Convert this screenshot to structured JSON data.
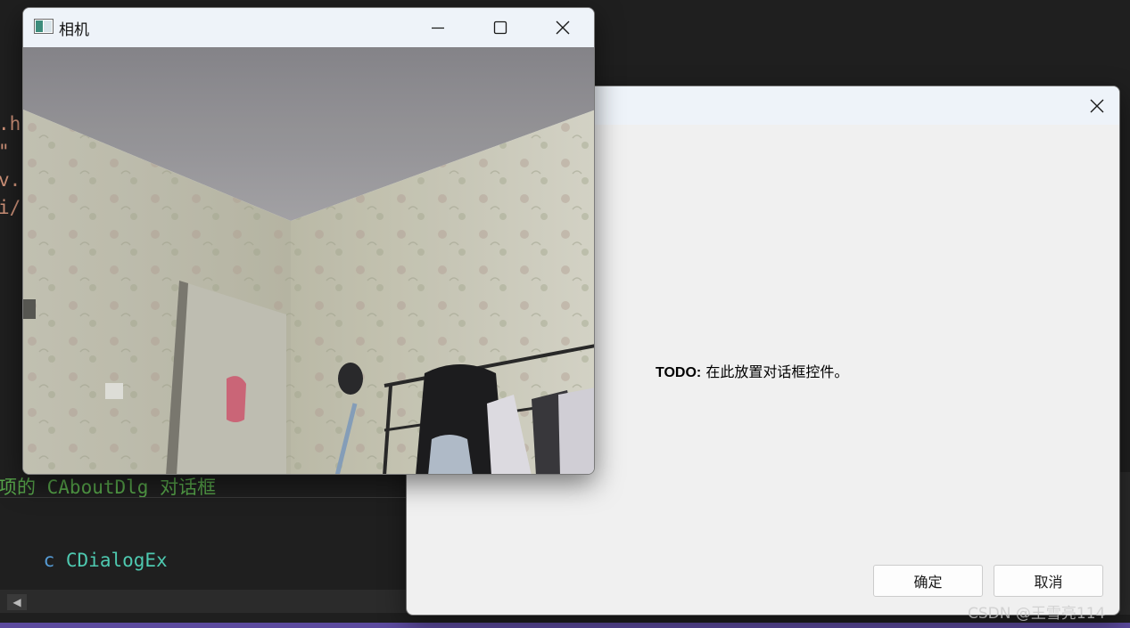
{
  "editor": {
    "code_lines": [
      {
        "text": ".h",
        "color": "#ce9178"
      },
      {
        "text": "\"",
        "color": "#ce9178"
      },
      {
        "text": "v.",
        "color": "#ce9178"
      },
      {
        "text": "i/",
        "color": "#ce9178"
      }
    ],
    "comment_line": "项的 CAboutDlg 对话框",
    "class_line_keyword": "c",
    "class_line_type": "CDialogEx",
    "scroll_left_glyph": "◀"
  },
  "camera_window": {
    "title": "相机",
    "icon": "app-window-icon",
    "buttons": {
      "minimize_icon": "minimize-icon",
      "maximize_icon": "maximize-icon",
      "close_icon": "close-icon"
    }
  },
  "dialog": {
    "title": "",
    "close_icon": "close-icon",
    "todo_label": "TODO:",
    "todo_text": " 在此放置对话框控件。",
    "ok_label": "确定",
    "cancel_label": "取消"
  },
  "watermark": "CSDN @王雪亮114"
}
